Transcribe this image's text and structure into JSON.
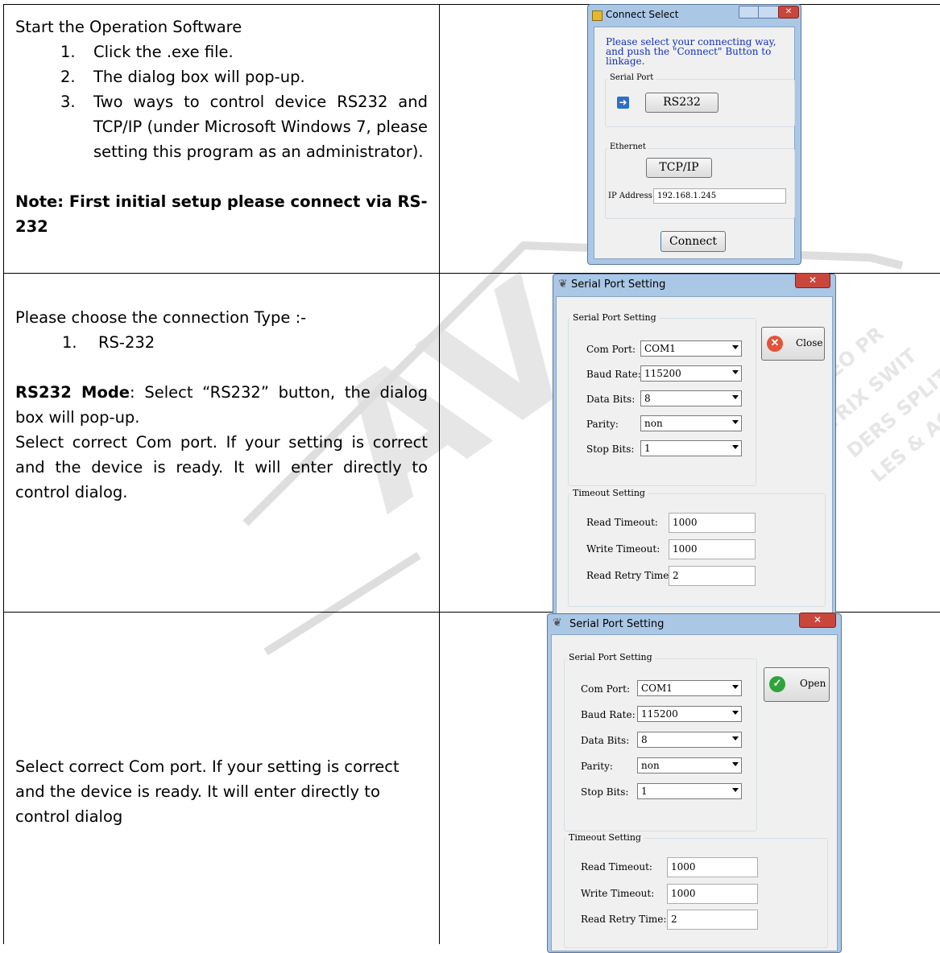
{
  "row1": {
    "heading": "Start the Operation Software",
    "steps": [
      {
        "num": "1.",
        "text": "Click the .exe file."
      },
      {
        "num": "2.",
        "text": "The dialog box will pop-up."
      },
      {
        "num": "3.",
        "text": "Two ways to control device RS232 and TCP/IP (under Microsoft Windows 7, please setting this program as an administrator)."
      }
    ],
    "note": "Note: First initial setup please connect via RS-232"
  },
  "row2": {
    "intro": "Please choose the connection Type :-",
    "list_num": "1.",
    "list_item": "RS-232",
    "mode_bold": "RS232 Mode",
    "mode_rest": ": Select “RS232” button, the dialog box will pop-up.",
    "para": "Select correct Com port. If your setting is correct and the device is ready. It will enter directly to control dialog."
  },
  "row3": {
    "para": "Select correct Com port. If your setting is correct and the device is ready. It will enter directly to control dialog"
  },
  "connect_dialog": {
    "title": "Connect Select",
    "instruction": "Please select your connecting way, and push the \"Connect\" Button to linkage.",
    "serial_group": "Serial Port",
    "rs232_button": "RS232",
    "ethernet_group": "Ethernet",
    "tcpip_button": "TCP/IP",
    "ip_label": "IP Address:",
    "ip_value": "192.168.1.245",
    "connect_button": "Connect"
  },
  "serial_dialog_1": {
    "title": "Serial Port Setting",
    "group_title": "Serial Port Setting",
    "com_label": "Com Port:",
    "com_value": "COM1",
    "baud_label": "Baud Rate:",
    "baud_value": "115200",
    "data_label": "Data Bits:",
    "data_value": "8",
    "parity_label": "Parity:",
    "parity_value": "non",
    "stop_label": "Stop Bits:",
    "stop_value": "1",
    "action_button": "Close",
    "timeout_group": "Timeout Setting",
    "read_label": "Read Timeout:",
    "read_value": "1000",
    "write_label": "Write Timeout:",
    "write_value": "1000",
    "retry_label": "Read Retry Time:",
    "retry_value": "2"
  },
  "serial_dialog_2": {
    "title": "Serial Port Setting",
    "group_title": "Serial Port Setting",
    "com_label": "Com Port:",
    "com_value": "COM1",
    "baud_label": "Baud Rate:",
    "baud_value": "115200",
    "data_label": "Data Bits:",
    "data_value": "8",
    "parity_label": "Parity:",
    "parity_value": "non",
    "stop_label": "Stop Bits:",
    "stop_value": "1",
    "action_button": "Open",
    "timeout_group": "Timeout Setting",
    "read_label": "Read Timeout:",
    "read_value": "1000",
    "write_label": "Write Timeout:",
    "write_value": "1000",
    "retry_label": "Read Retry Time:",
    "retry_value": "2"
  },
  "colors": {
    "title_blue": "#aac7e6",
    "close_red": "#c9463d",
    "ok_green": "#2fa33b",
    "arrow_blue": "#2e6fc7"
  }
}
